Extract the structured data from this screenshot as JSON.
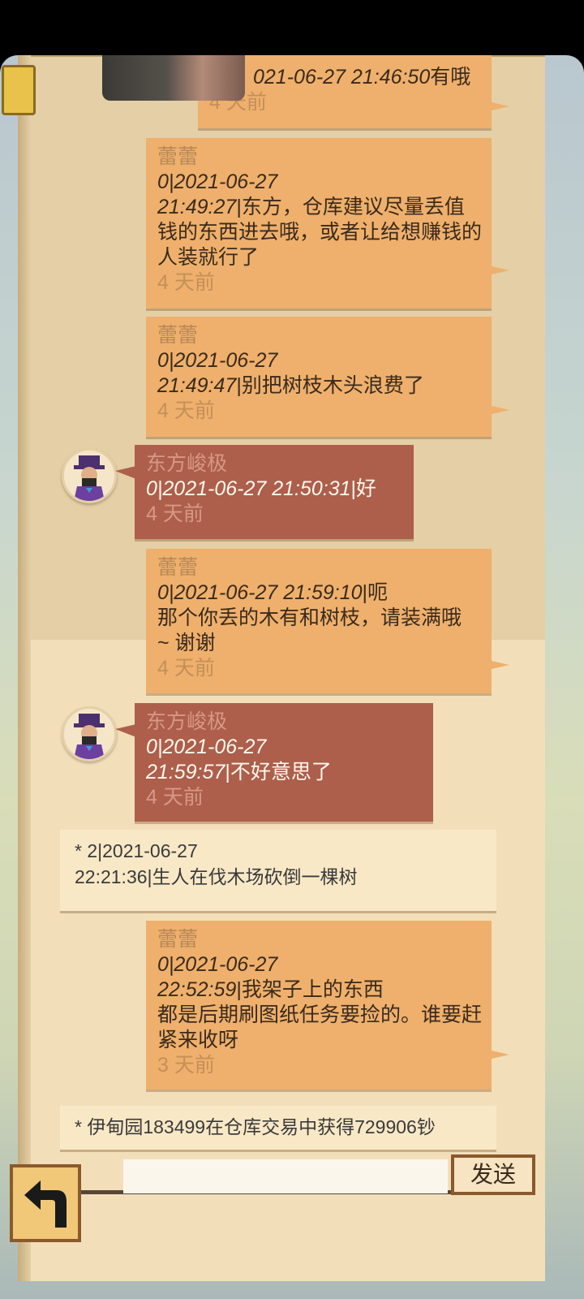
{
  "messages": [
    {
      "type": "other",
      "sender": "",
      "meta": "021-06-27 21:46:50",
      "text": "有哦",
      "time": "4 天前"
    },
    {
      "type": "other",
      "sender": "蕾蕾",
      "meta": "0|2021-06-27",
      "meta2": "21:49:27",
      "text": "|东方，仓库建议尽量丢值钱的东西进去哦，或者让给想赚钱的人装就行了",
      "time": "4 天前"
    },
    {
      "type": "other",
      "sender": "蕾蕾",
      "meta": "0|2021-06-27",
      "meta2": "21:49:47",
      "text": "|别把树枝木头浪费了",
      "time": "4 天前"
    },
    {
      "type": "me",
      "sender": "东方峻极",
      "meta": "0|2021-06-27 21:50:31",
      "text": "|好",
      "time": "4 天前"
    },
    {
      "type": "other",
      "sender": "蕾蕾",
      "meta": "0|2021-06-27 21:59:10",
      "text": "|呃",
      "text2": "那个你丢的木有和树枝，请装满哦",
      "text3": "~ 谢谢",
      "time": "4 天前"
    },
    {
      "type": "me",
      "sender": "东方峻极",
      "meta": "0|2021-06-27",
      "meta2": "21:59:57",
      "text": "|不好意思了",
      "time": "4 天前"
    },
    {
      "type": "system",
      "line1": "* 2|2021-06-27",
      "line2": "22:21:36|生人在伐木场砍倒一棵树"
    },
    {
      "type": "other",
      "sender": "蕾蕾",
      "meta": "0|2021-06-27",
      "meta2": "22:52:59",
      "text": "|我架子上的东西",
      "text2": "都是后期刷图纸任务要捡的。谁要赶紧来收呀",
      "time": "3 天前"
    },
    {
      "type": "system",
      "line1": "* 伊甸园183499在仓库交易中获得729906钞"
    }
  ],
  "input": {
    "placeholder": ""
  },
  "send_label": "发送"
}
